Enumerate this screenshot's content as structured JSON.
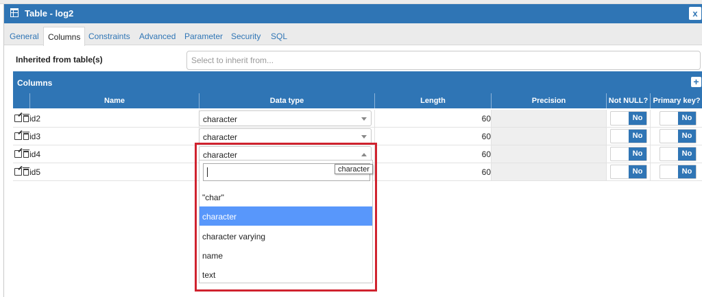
{
  "window": {
    "title": "Table - log2",
    "close_label": "x"
  },
  "tabs": [
    {
      "label": "General"
    },
    {
      "label": "Columns",
      "active": true
    },
    {
      "label": "Constraints"
    },
    {
      "label": "Advanced"
    },
    {
      "label": "Parameter"
    },
    {
      "label": "Security"
    },
    {
      "label": "SQL"
    }
  ],
  "inherited": {
    "label": "Inherited from table(s)",
    "placeholder": "Select to inherit from..."
  },
  "columns_grid": {
    "title": "Columns",
    "add_label": "+",
    "headers": [
      "Name",
      "Data type",
      "Length",
      "Precision",
      "Not NULL?",
      "Primary key?"
    ],
    "rows": [
      {
        "name": "id2",
        "data_type": "character",
        "length": "60",
        "not_null": "No",
        "primary_key": "No"
      },
      {
        "name": "id3",
        "data_type": "character",
        "length": "60",
        "not_null": "No",
        "primary_key": "No"
      },
      {
        "name": "id4",
        "data_type": "character",
        "length": "60",
        "not_null": "No",
        "primary_key": "No"
      },
      {
        "name": "id5",
        "data_type": "",
        "length": "60",
        "not_null": "No",
        "primary_key": "No"
      }
    ]
  },
  "dropdown": {
    "search_value": "",
    "tooltip": "character",
    "options": [
      "\"char\"",
      "character",
      "character varying",
      "name",
      "text"
    ],
    "highlighted": "character"
  },
  "colors": {
    "accent": "#2f75b5",
    "highlight_border": "#d0222e",
    "option_highlight": "#5897fb"
  },
  "icons": {
    "title": "table-icon",
    "row_edit": "edit-icon",
    "row_delete": "trash-icon",
    "add": "plus-icon",
    "close": "close-icon"
  }
}
